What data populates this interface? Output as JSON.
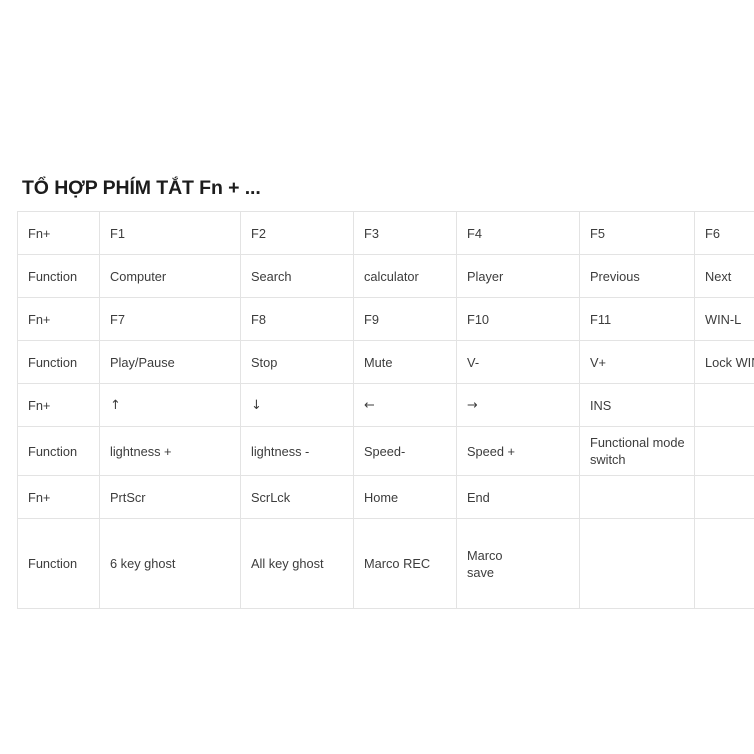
{
  "document": {
    "title": "TỔ HỢP PHÍM TẮT Fn + ..."
  },
  "table": {
    "name": "fn-shortcut-table",
    "columns": 7,
    "rows": [
      {
        "type": "key-row",
        "cells": [
          "Fn+",
          "F1",
          "F2",
          "F3",
          "F4",
          "F5",
          "F6"
        ]
      },
      {
        "type": "function-row",
        "cells": [
          "Function",
          "Computer",
          "Search",
          "calculator",
          "Player",
          "Previous",
          "Next"
        ]
      },
      {
        "type": "key-row",
        "cells": [
          "Fn+",
          "F7",
          "F8",
          "F9",
          "F10",
          "F11",
          "WIN-L"
        ]
      },
      {
        "type": "function-row",
        "cells": [
          "Function",
          "Play/Pause",
          "Stop",
          "Mute",
          "V-",
          "V+",
          "Lock WIN"
        ]
      },
      {
        "type": "key-row",
        "cells": [
          "Fn+",
          "↑",
          "↓",
          "←",
          "→",
          "INS",
          ""
        ]
      },
      {
        "type": "function-row",
        "cells": [
          "Function",
          "lightness +",
          "lightness -",
          "Speed-",
          "Speed +",
          "Functional mode switch",
          ""
        ]
      },
      {
        "type": "key-row",
        "cells": [
          "Fn+",
          "PrtScr",
          "ScrLck",
          "Home",
          "End",
          "",
          ""
        ]
      },
      {
        "type": "function-row",
        "cells": [
          "Function",
          "6 key ghost",
          "All key ghost",
          "Marco REC",
          "Marco\nsave",
          "",
          ""
        ]
      }
    ]
  },
  "colors": {
    "background": "#ffffff",
    "title_text": "#1c1c1c",
    "cell_text": "#3c3c3c",
    "border": "#e3e3e3"
  }
}
